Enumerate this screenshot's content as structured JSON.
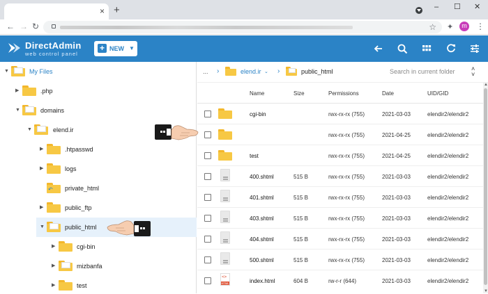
{
  "browser": {
    "new_tab_glyph": "+",
    "close_tab_glyph": "×",
    "window_controls": [
      "–",
      "☐",
      "✕"
    ],
    "back_glyph": "←",
    "forward_glyph": "→",
    "reload_glyph": "↻",
    "star_glyph": "☆",
    "extensions_glyph": "✦",
    "avatar_letter": "m",
    "menu_glyph": "⋮"
  },
  "header": {
    "brand": "DirectAdmin",
    "tagline": "web control panel",
    "new_button": "NEW",
    "colors": {
      "bar": "#2b83c6"
    }
  },
  "tree": {
    "root": "My Files",
    "items": [
      {
        "label": ".php"
      },
      {
        "label": "domains"
      },
      {
        "label": "elend.ir"
      },
      {
        "label": ".htpasswd"
      },
      {
        "label": "logs"
      },
      {
        "label": "private_html"
      },
      {
        "label": "public_ftp"
      },
      {
        "label": "public_html"
      },
      {
        "label": "cgi-bin"
      },
      {
        "label": "mizbanfa"
      },
      {
        "label": "test"
      }
    ]
  },
  "breadcrumb": {
    "ellipsis": "...",
    "domain": "elend.ir",
    "current": "public_html",
    "search_placeholder": "Search in current folder"
  },
  "table": {
    "columns": [
      "Name",
      "Size",
      "Permissions",
      "Date",
      "UID/GID"
    ],
    "rows": [
      {
        "name": "cgi-bin",
        "size": "",
        "perm": "rwx-rx-rx (755)",
        "date": "2021-03-03",
        "uid": "elendir2/elendir2"
      },
      {
        "name": "",
        "size": "",
        "perm": "rwx-rx-rx (755)",
        "date": "2021-04-25",
        "uid": "elendir2/elendir2"
      },
      {
        "name": "test",
        "size": "",
        "perm": "rwx-rx-rx (755)",
        "date": "2021-04-25",
        "uid": "elendir2/elendir2"
      },
      {
        "name": "400.shtml",
        "size": "515 B",
        "perm": "rwx-rx-rx (755)",
        "date": "2021-03-03",
        "uid": "elendir2/elendir2"
      },
      {
        "name": "401.shtml",
        "size": "515 B",
        "perm": "rwx-rx-rx (755)",
        "date": "2021-03-03",
        "uid": "elendir2/elendir2"
      },
      {
        "name": "403.shtml",
        "size": "515 B",
        "perm": "rwx-rx-rx (755)",
        "date": "2021-03-03",
        "uid": "elendir2/elendir2"
      },
      {
        "name": "404.shtml",
        "size": "515 B",
        "perm": "rwx-rx-rx (755)",
        "date": "2021-03-03",
        "uid": "elendir2/elendir2"
      },
      {
        "name": "500.shtml",
        "size": "515 B",
        "perm": "rwx-rx-rx (755)",
        "date": "2021-03-03",
        "uid": "elendir2/elendir2"
      },
      {
        "name": "index.html",
        "size": "604 B",
        "perm": "rw-r-r (644)",
        "date": "2021-03-03",
        "uid": "elendir2/elendir2"
      }
    ]
  },
  "icons": {
    "html_file_code": "<>",
    "html_file_tag": "HTML"
  }
}
